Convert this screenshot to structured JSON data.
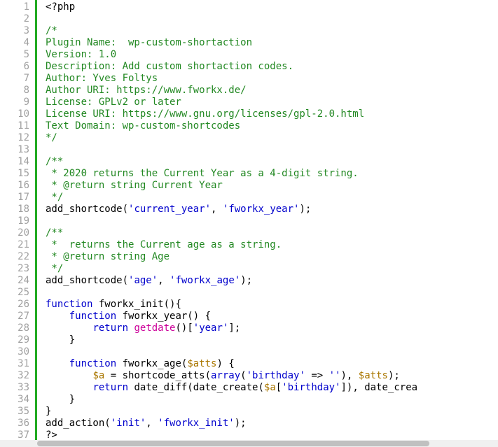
{
  "lines": [
    {
      "n": 1
    },
    {
      "n": 2
    },
    {
      "n": 3
    },
    {
      "n": 4
    },
    {
      "n": 5
    },
    {
      "n": 6
    },
    {
      "n": 7
    },
    {
      "n": 8
    },
    {
      "n": 9
    },
    {
      "n": 10
    },
    {
      "n": 11
    },
    {
      "n": 12
    },
    {
      "n": 13
    },
    {
      "n": 14
    },
    {
      "n": 15
    },
    {
      "n": 16
    },
    {
      "n": 17
    },
    {
      "n": 18
    },
    {
      "n": 19
    },
    {
      "n": 20
    },
    {
      "n": 21
    },
    {
      "n": 22
    },
    {
      "n": 23
    },
    {
      "n": 24
    },
    {
      "n": 25
    },
    {
      "n": 26
    },
    {
      "n": 27
    },
    {
      "n": 28
    },
    {
      "n": 29
    },
    {
      "n": 30
    },
    {
      "n": 31
    },
    {
      "n": 32
    },
    {
      "n": 33
    },
    {
      "n": 34
    },
    {
      "n": 35
    },
    {
      "n": 36
    },
    {
      "n": 37
    }
  ],
  "code": {
    "l1": "<?php",
    "l3": "/*",
    "l4": "Plugin Name:  wp-custom-shortaction",
    "l5": "Version: 1.0",
    "l6": "Description: Add custom shortaction codes.",
    "l7": "Author: Yves Foltys",
    "l8": "Author URI: https://www.fworkx.de/",
    "l9": "License: GPLv2 or later",
    "l10": "License URI: https://www.gnu.org/licenses/gpl-2.0.html",
    "l11": "Text Domain: wp-custom-shortcodes",
    "l12": "*/",
    "l14": "/**",
    "l15": " * 2020 returns the Current Year as a 4-digit string.",
    "l16": " * @return string Current Year",
    "l17": " */",
    "l18_a": "add_shortcode(",
    "l18_b": "'current_year'",
    "l18_c": ", ",
    "l18_d": "'fworkx_year'",
    "l18_e": ");",
    "l20": "/**",
    "l21": " *  returns the Current age as a string.",
    "l22": " * @return string Age",
    "l23": " */",
    "l24_a": "add_shortcode(",
    "l24_b": "'age'",
    "l24_c": ", ",
    "l24_d": "'fworkx_age'",
    "l24_e": ");",
    "l26_a": "function",
    "l26_b": " fworkx_init(){",
    "l27_a": "    ",
    "l27_b": "function",
    "l27_c": " fworkx_year() {",
    "l28_a": "        ",
    "l28_b": "return",
    "l28_c": " ",
    "l28_d": "getdate",
    "l28_e": "()[",
    "l28_f": "'year'",
    "l28_g": "];",
    "l29": "    }",
    "l31_a": "    ",
    "l31_b": "function",
    "l31_c": " fworkx_age(",
    "l31_d": "$atts",
    "l31_e": ") {",
    "l32_a": "        ",
    "l32_b": "$a",
    "l32_c": " = shortcode_atts(",
    "l32_d": "array",
    "l32_e": "(",
    "l32_f": "'birthday'",
    "l32_g": " => ",
    "l32_h": "''",
    "l32_i": "), ",
    "l32_j": "$atts",
    "l32_k": ");",
    "l33_a": "        ",
    "l33_b": "return",
    "l33_c": " date_diff(date_create(",
    "l33_d": "$a",
    "l33_e": "[",
    "l33_f": "'birthday'",
    "l33_g": "]), date_crea",
    "l34": "    }",
    "l35": "}",
    "l36_a": "add_action(",
    "l36_b": "'init'",
    "l36_c": ", ",
    "l36_d": "'fworkx_init'",
    "l36_e": ");",
    "l37": "?>"
  }
}
